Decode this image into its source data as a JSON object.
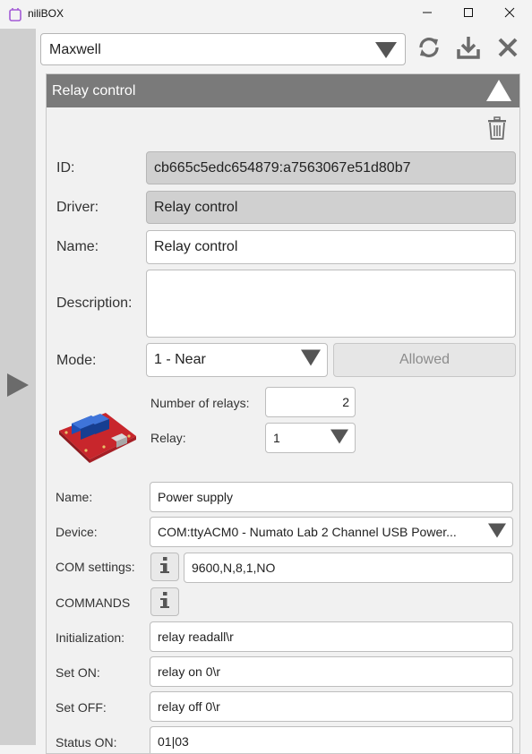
{
  "window": {
    "title": "niliBOX"
  },
  "toolbar": {
    "profile_value": "Maxwell"
  },
  "card": {
    "title": "Relay control",
    "id_label": "ID:",
    "id_value": "cb665c5edc654879:a7563067e51d80b7",
    "driver_label": "Driver:",
    "driver_value": "Relay control",
    "name_label": "Name:",
    "name_value": "Relay control",
    "description_label": "Description:",
    "description_value": "",
    "mode_label": "Mode:",
    "mode_value": "1 - Near",
    "allowed_label": "Allowed",
    "relays_count_label": "Number of relays:",
    "relays_count_value": "2",
    "relay_label": "Relay:",
    "relay_value": "1",
    "relay_name_label": "Name:",
    "relay_name_value": "Power supply",
    "device_label": "Device:",
    "device_value": "COM:ttyACM0 - Numato Lab 2 Channel USB Power...",
    "com_settings_label": "COM settings:",
    "com_settings_value": "9600,N,8,1,NO",
    "commands_label": "COMMANDS",
    "init_label": "Initialization:",
    "init_value": "relay readall\\r",
    "set_on_label": "Set ON:",
    "set_on_value": "relay on 0\\r",
    "set_off_label": "Set OFF:",
    "set_off_value": "relay off 0\\r",
    "status_on_label": "Status ON:",
    "status_on_value": "01|03"
  },
  "icons": {
    "app": "app-icon",
    "minimize": "minimize-icon",
    "maximize": "maximize-icon",
    "close": "close-icon",
    "refresh": "refresh-icon",
    "download": "download-icon",
    "collapse": "collapse-up-icon",
    "trash": "trash-icon",
    "info": "info-icon",
    "expand": "expand-right-icon"
  },
  "colors": {
    "card_header": "#7a7a7a",
    "side_panel": "#cfcfcf"
  }
}
